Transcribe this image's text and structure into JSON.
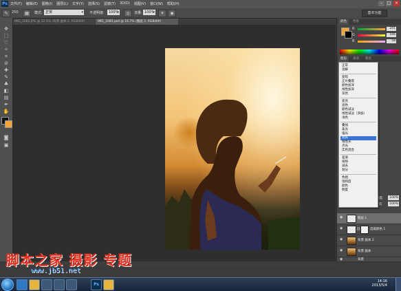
{
  "app": {
    "logo": "Ps",
    "menu": [
      "文件(F)",
      "编辑(E)",
      "图像(I)",
      "图层(L)",
      "文字(Y)",
      "选择(S)",
      "滤镜(T)",
      "3D(D)",
      "视图(V)",
      "窗口(W)",
      "帮助(H)"
    ],
    "window_controls": [
      "–",
      "□",
      "×"
    ]
  },
  "options_bar": {
    "mode_label": "模式:",
    "mode_value": "正常",
    "opacity_label": "不透明度:",
    "opacity_value": "100%",
    "flow_label": "流量:",
    "flow_value": "100%",
    "brush_size": "250",
    "workspace": "基本功能"
  },
  "document_tabs": [
    {
      "label": "IMG_1085.JPG @ 12.5% (背景 副本 2, RGB/8#)",
      "active": false
    },
    {
      "label": "IMG_1085.psd @ 16.7% (图层 2, RGB/8#)",
      "active": true
    }
  ],
  "color_panel": {
    "tabs": [
      "颜色",
      "色板"
    ],
    "labels": [
      "R",
      "G",
      "B"
    ],
    "values": [
      "241",
      "166",
      "58"
    ],
    "swatch_color": "#f1a63a"
  },
  "layers_panel": {
    "tabs": [
      "图层",
      "通道",
      "路径"
    ],
    "blend_label": "正常",
    "opacity_label": "不透明度:",
    "opacity_value": "100%",
    "fill_label": "填充:",
    "fill_value": "100%",
    "lock_label": "锁定:",
    "layers": [
      {
        "name": "图层 1",
        "active": true,
        "thumb": "color"
      },
      {
        "name": "选取颜色 1",
        "active": false,
        "thumb": "mask"
      },
      {
        "name": "背景 副本 2",
        "active": false,
        "thumb": "photo"
      },
      {
        "name": "背景 副本",
        "active": false,
        "thumb": "photo"
      },
      {
        "name": "背景",
        "active": false,
        "thumb": "photo"
      }
    ]
  },
  "blend_menu": {
    "groups": [
      [
        "正常",
        "溶解"
      ],
      [
        "变暗",
        "正片叠底",
        "颜色加深",
        "线性加深",
        "深色"
      ],
      [
        "变亮",
        "滤色",
        "颜色减淡",
        "线性减淡（添加）",
        "浅色"
      ],
      [
        "叠加",
        "柔光",
        "强光",
        "亮光",
        "线性光",
        "点光",
        "实色混合"
      ],
      [
        "差值",
        "排除",
        "减去",
        "划分"
      ],
      [
        "色相",
        "饱和度",
        "颜色",
        "明度"
      ]
    ],
    "selected": "亮光"
  },
  "watermark": {
    "main": "脚本之家 摄影 专题",
    "url": "www.jb51.net"
  },
  "taskbar": {
    "time": "14:16",
    "date": "2013/5/4"
  }
}
